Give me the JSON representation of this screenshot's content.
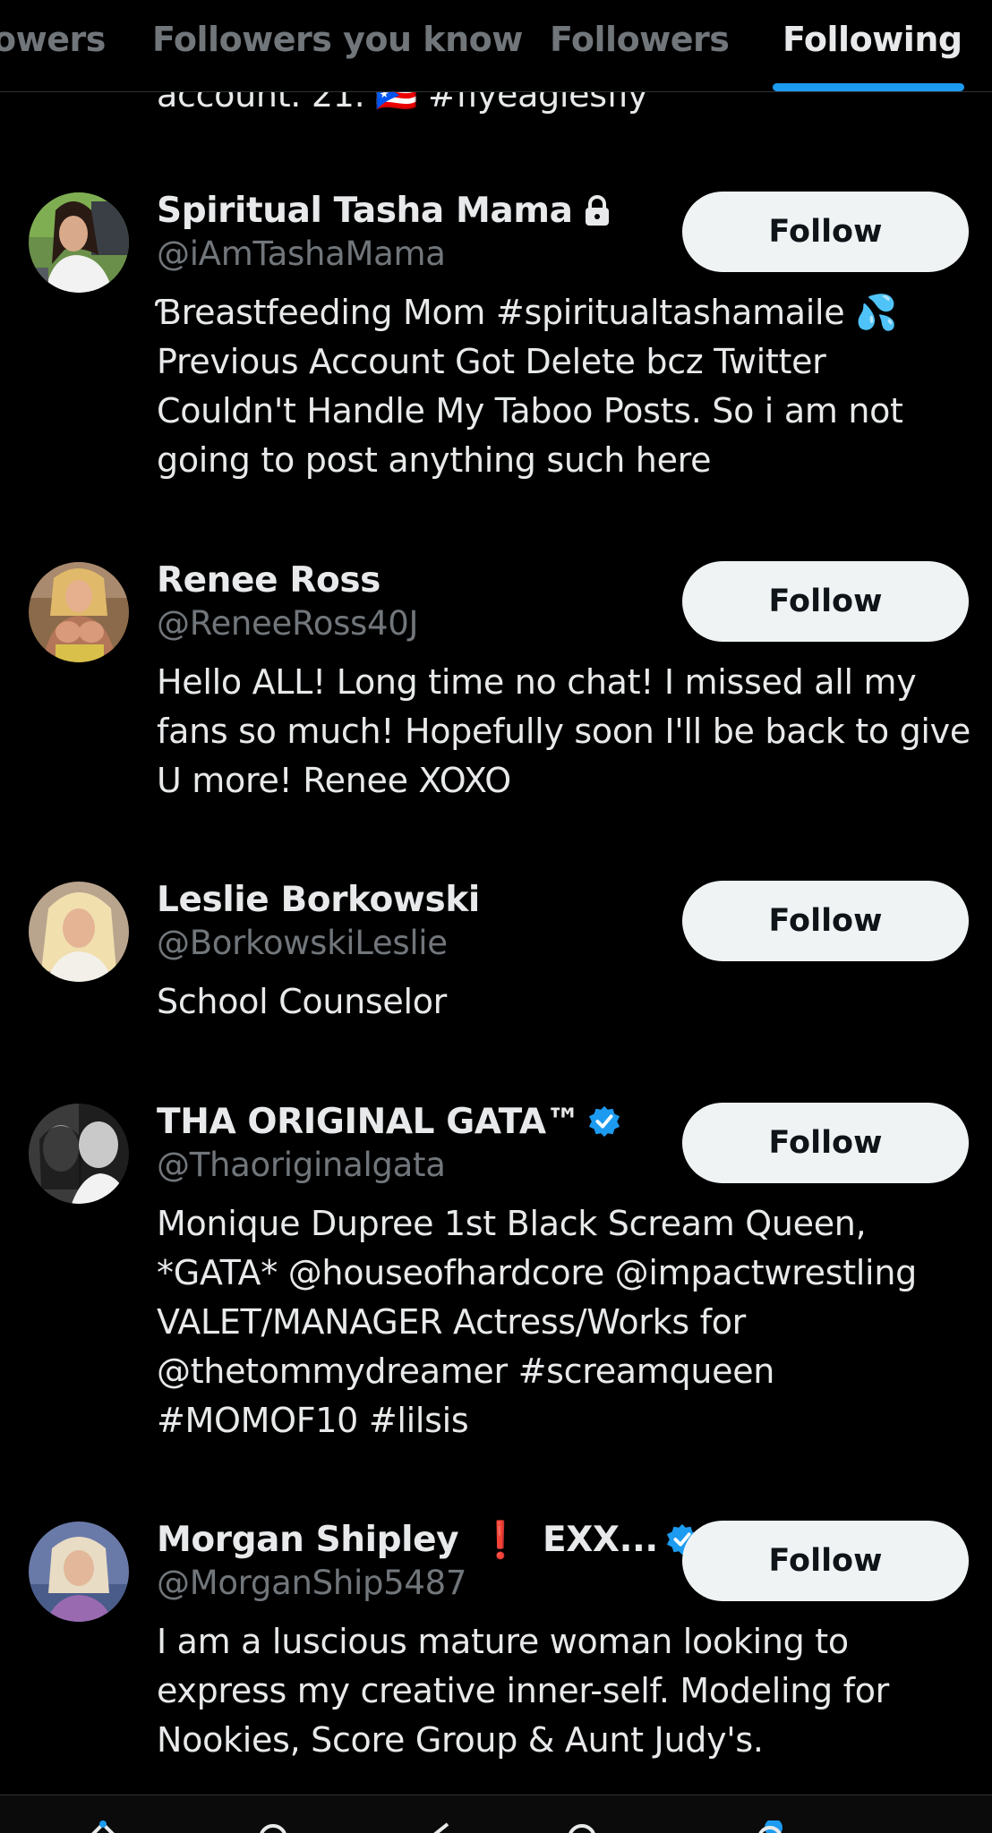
{
  "tabs": [
    {
      "label": "owers",
      "active": false
    },
    {
      "label": "Followers you know",
      "active": false
    },
    {
      "label": "Followers",
      "active": false
    },
    {
      "label": "Following",
      "active": true
    }
  ],
  "cut_off_bio": "account. 21. 🇵🇷 #flyeaglesfly",
  "users": [
    {
      "name": "Spiritual Tasha Mama",
      "handle": "@iAmTashaMama",
      "bio_lines": [
        "Ɓreastfeeding Mom #spiritualtashamaile 💦",
        "Previous Account Got Delete bcz Twitter",
        "Couldn't Handle My Taboo Posts. So i am not",
        "going to post anything such here"
      ],
      "follow_label": "Follow",
      "icon": "lock-icon"
    },
    {
      "name": "Renee Ross",
      "handle": "@ReneeRoss40J",
      "bio_lines": [
        "Hello ALL! Long time no chat! I missed all my",
        "fans so much! Hopefully soon I'll be back to give",
        "U more! Renee XOXO"
      ],
      "follow_label": "Follow"
    },
    {
      "name": "Leslie Borkowski",
      "handle": "@BorkowskiLeslie",
      "bio_lines": [
        "School Counselor"
      ],
      "follow_label": "Follow"
    },
    {
      "name": "THA ORIGINAL GATA™",
      "handle": "@Thaoriginalgata",
      "bio_lines": [
        "Monique Dupree 1st Black Scream Queen,",
        "*GATA* @houseofhardcore @impactwrestling",
        "VALET/MANAGER Actress/Works for",
        "@thetommydreamer #screamqueen",
        "#MOMOF10 #lilsis"
      ],
      "follow_label": "Follow",
      "icon": "verified-icon"
    },
    {
      "name_part1": "Morgan Shipley",
      "name_alert": "❗",
      "name_part2": "EXX...",
      "handle": "@MorganShip5487",
      "bio_lines": [
        "I am a luscious mature woman looking to",
        "express my creative inner-self. Modeling for",
        "Nookies, Score Group & Aunt Judy's."
      ],
      "follow_label": "Follow",
      "icon": "verified-icon"
    }
  ],
  "colors": {
    "background": "#000000",
    "primary_text": "#e7e9ea",
    "secondary_text": "#71767b",
    "accent": "#1d9bf0",
    "button_bg": "#eff3f4",
    "button_text": "#0f1419"
  }
}
